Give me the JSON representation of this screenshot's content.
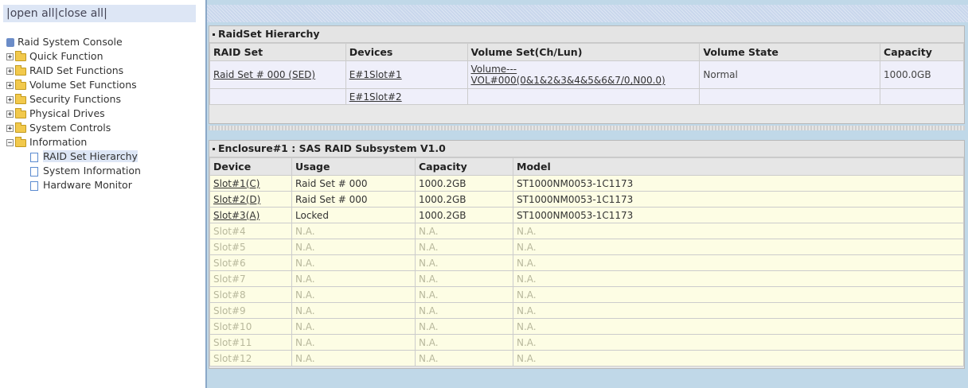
{
  "nav": {
    "open_all": "open all",
    "close_all": "close all",
    "tree": {
      "root": "Raid System Console",
      "items": [
        {
          "label": "Quick Function",
          "expanded": false
        },
        {
          "label": "RAID Set Functions",
          "expanded": false
        },
        {
          "label": "Volume Set Functions",
          "expanded": false
        },
        {
          "label": "Security Functions",
          "expanded": false
        },
        {
          "label": "Physical Drives",
          "expanded": false
        },
        {
          "label": "System Controls",
          "expanded": false
        },
        {
          "label": "Information",
          "expanded": true
        }
      ],
      "info_children": [
        "RAID Set Hierarchy",
        "System Information",
        "Hardware Monitor"
      ],
      "selected": "RAID Set Hierarchy"
    }
  },
  "raidset": {
    "title": "RaidSet Hierarchy",
    "headers": [
      "RAID Set",
      "Devices",
      "Volume Set(Ch/Lun)",
      "Volume State",
      "Capacity"
    ],
    "rows": [
      {
        "raid_set": "Raid Set # 000 (SED)",
        "device": "E#1Slot#1",
        "volume_line1": "Volume---",
        "volume_line2": "VOL#000(0&1&2&3&4&5&6&7/0,N00.0)",
        "state": "Normal",
        "capacity": "1000.0GB"
      },
      {
        "raid_set": "",
        "device": "E#1Slot#2",
        "volume_line1": "",
        "volume_line2": "",
        "state": "",
        "capacity": ""
      }
    ]
  },
  "enclosure": {
    "title": "Enclosure#1 : SAS RAID Subsystem V1.0",
    "headers": [
      "Device",
      "Usage",
      "Capacity",
      "Model"
    ],
    "rows": [
      {
        "device": "Slot#1(C)",
        "usage": "Raid Set # 000",
        "capacity": "1000.2GB",
        "model": "ST1000NM0053-1C1173"
      },
      {
        "device": "Slot#2(D)",
        "usage": "Raid Set # 000",
        "capacity": "1000.2GB",
        "model": "ST1000NM0053-1C1173"
      },
      {
        "device": "Slot#3(A)",
        "usage": "Locked",
        "capacity": "1000.2GB",
        "model": "ST1000NM0053-1C1173"
      },
      {
        "device": "Slot#4",
        "usage": "N.A.",
        "capacity": "N.A.",
        "model": "N.A."
      },
      {
        "device": "Slot#5",
        "usage": "N.A.",
        "capacity": "N.A.",
        "model": "N.A."
      },
      {
        "device": "Slot#6",
        "usage": "N.A.",
        "capacity": "N.A.",
        "model": "N.A."
      },
      {
        "device": "Slot#7",
        "usage": "N.A.",
        "capacity": "N.A.",
        "model": "N.A."
      },
      {
        "device": "Slot#8",
        "usage": "N.A.",
        "capacity": "N.A.",
        "model": "N.A."
      },
      {
        "device": "Slot#9",
        "usage": "N.A.",
        "capacity": "N.A.",
        "model": "N.A."
      },
      {
        "device": "Slot#10",
        "usage": "N.A.",
        "capacity": "N.A.",
        "model": "N.A."
      },
      {
        "device": "Slot#11",
        "usage": "N.A.",
        "capacity": "N.A.",
        "model": "N.A."
      },
      {
        "device": "Slot#12",
        "usage": "N.A.",
        "capacity": "N.A.",
        "model": "N.A."
      }
    ]
  },
  "colors": {
    "state_normal": "#cc0000",
    "accent": "#dde6f5"
  }
}
